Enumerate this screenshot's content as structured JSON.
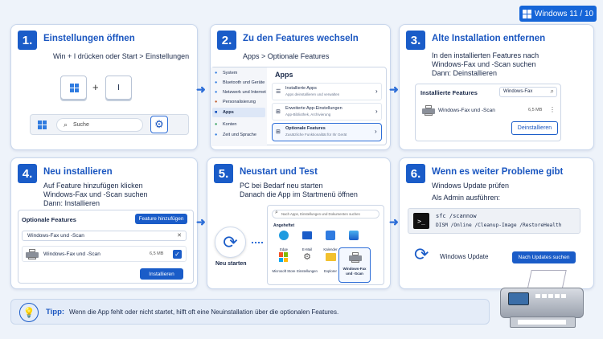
{
  "badge": {
    "label": "Windows 11 / 10"
  },
  "steps": [
    {
      "num": "1.",
      "title": "Einstellungen öffnen",
      "lines": [
        "Win + I drücken oder Start > Einstellungen"
      ],
      "keys": {
        "plus": "+",
        "i": "I"
      },
      "taskbar": {
        "search": "Suche"
      }
    },
    {
      "num": "2.",
      "title": "Zu den Features wechseln",
      "lines": [
        "Apps > Optionale Features"
      ],
      "settings": {
        "heading": "Apps",
        "side": [
          "System",
          "Bluetooth und Geräte",
          "Netzwerk und Internet",
          "Personalisierung",
          "Apps",
          "Konten",
          "Zeit und Sprache"
        ],
        "items": [
          {
            "title": "Installierte Apps",
            "sub": "Apps deinstallieren und verwalten"
          },
          {
            "title": "Erweiterte App-Einstellungen",
            "sub": "App-Bibliothek, Archivierung"
          },
          {
            "title": "Optionale Features",
            "sub": "Zusätzliche Funktionalität für Ihr Gerät"
          }
        ]
      }
    },
    {
      "num": "3.",
      "title": "Alte Installation entfernen",
      "lines": [
        "In den installierten Features nach",
        "Windows-Fax und -Scan suchen",
        "Dann: Deinstallieren"
      ],
      "panel": {
        "title": "Installierte Features",
        "search": "Windows-Fax",
        "item": "Windows-Fax und -Scan",
        "size": "6,5 MB",
        "button": "Deinstallieren"
      }
    },
    {
      "num": "4.",
      "title": "Neu installieren",
      "lines": [
        "Auf Feature hinzufügen klicken",
        "Windows-Fax und -Scan suchen",
        "Dann: Installieren"
      ],
      "panel": {
        "title": "Optionale Features",
        "add": "Feature hinzufügen",
        "search": "Windows-Fax und -Scan",
        "item": "Windows-Fax und -Scan",
        "size": "6,5 MB",
        "button": "Installieren"
      }
    },
    {
      "num": "5.",
      "title": "Neustart und Test",
      "lines": [
        "PC bei Bedarf neu starten",
        "Danach die App im Startmenü öffnen"
      ],
      "restart": "Neu starten",
      "start": {
        "search": "Nach Apps, Einstellungen und Dokumenten suchen",
        "pinned": "Angeheftet",
        "apps": [
          "Edge",
          "E-Mail",
          "Kalender",
          "Fotos",
          "Microsoft Store",
          "Einstellungen",
          "Explorer",
          "Windows-Fax und -Scan"
        ]
      }
    },
    {
      "num": "6.",
      "title": "Wenn es weiter Probleme gibt",
      "lines": [
        "Windows Update prüfen",
        "Als Admin ausführen:"
      ],
      "cmd": [
        "sfc /scannow",
        "DISM /Online /Cleanup-Image /RestoreHealth"
      ],
      "update": {
        "label": "Windows Update",
        "button": "Nach Updates suchen"
      }
    }
  ],
  "tip": {
    "label": "Tipp:",
    "text": "Wenn die App fehlt oder nicht startet, hilft oft eine Neuinstallation über die optionalen Features."
  },
  "colors": {
    "accent": "#1a5cc8",
    "background": "#eef3fa"
  }
}
